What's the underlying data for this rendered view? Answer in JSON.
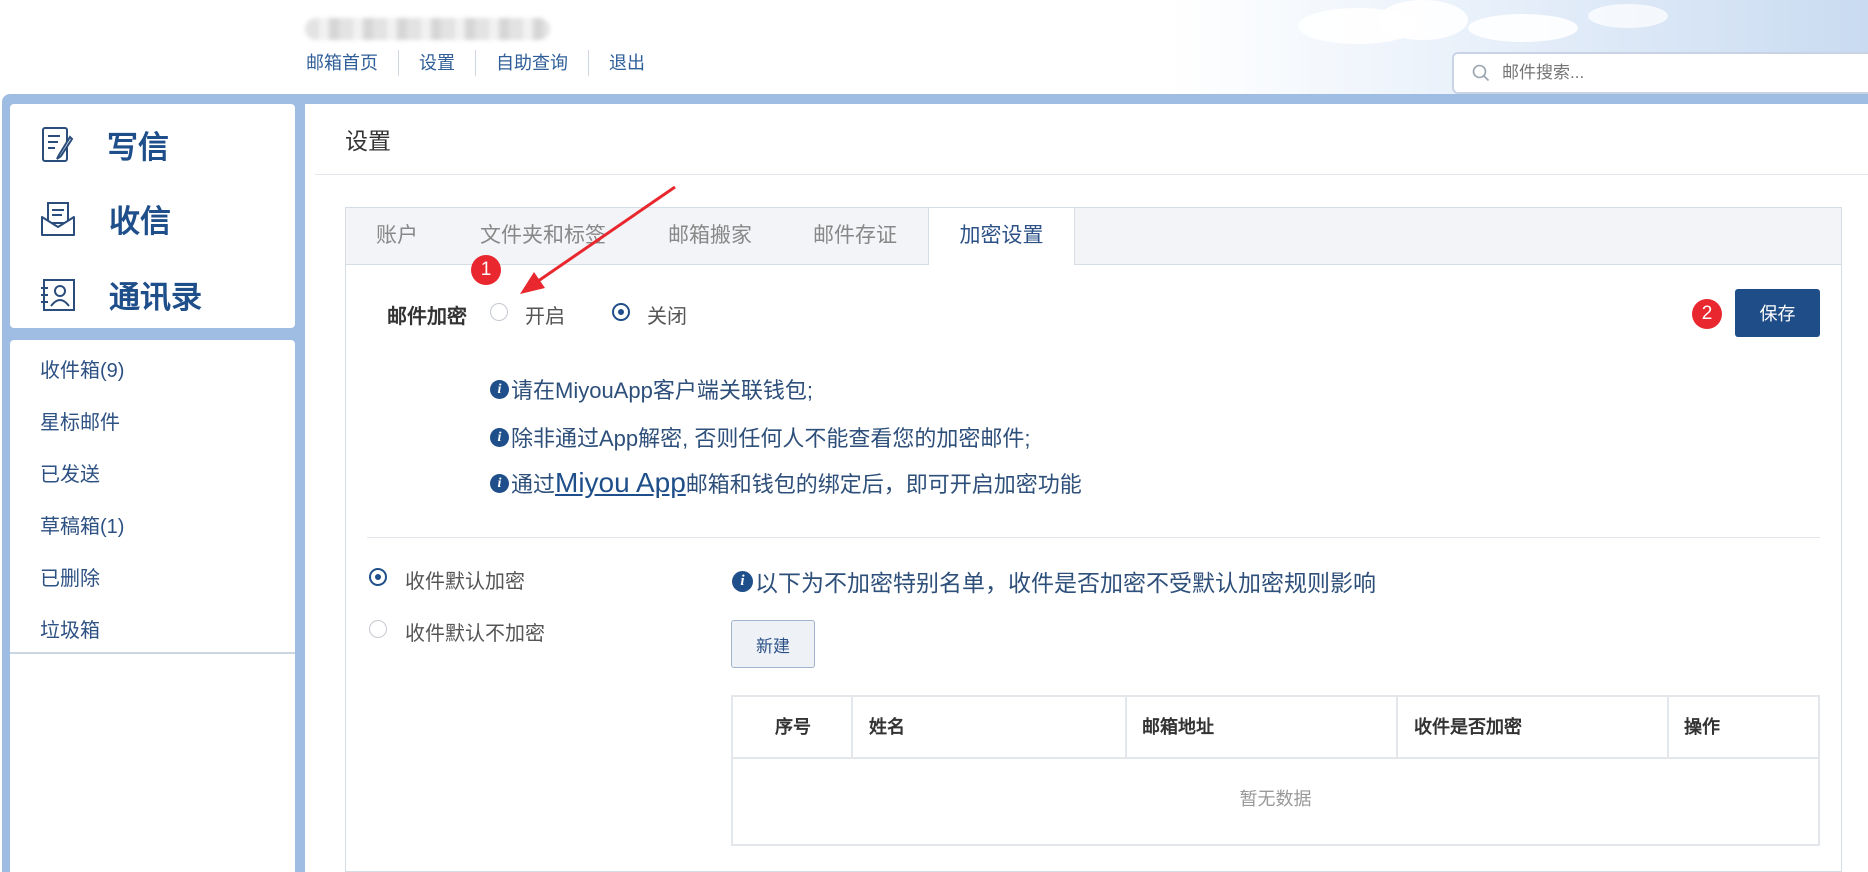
{
  "header": {
    "nav": [
      "邮箱首页",
      "设置",
      "自助查询",
      "退出"
    ],
    "search_placeholder": "邮件搜索..."
  },
  "sidebar": {
    "actions": [
      {
        "label": "写信",
        "icon": "compose-icon"
      },
      {
        "label": "收信",
        "icon": "inbox-envelope-icon"
      },
      {
        "label": "通讯录",
        "icon": "contacts-icon"
      }
    ],
    "folders": [
      "收件箱(9)",
      "星标邮件",
      "已发送",
      "草稿箱(1)",
      "已删除",
      "垃圾箱"
    ]
  },
  "main": {
    "title": "设置",
    "tabs": [
      "账户",
      "文件夹和标签",
      "邮箱搬家",
      "邮件存证",
      "加密设置"
    ],
    "active_tab": "加密设置",
    "encryption": {
      "label": "邮件加密",
      "options": [
        "开启",
        "关闭"
      ],
      "selected": "关闭"
    },
    "save_label": "保存",
    "badges": [
      "1",
      "2"
    ],
    "info": {
      "line1": "请在MiyouApp客户端关联钱包;",
      "line2": "除非通过App解密, 否则任何人不能查看您的加密邮件;",
      "line3_prefix": "通过",
      "line3_link": "Miyou App",
      "line3_suffix": "邮箱和钱包的绑定后，即可开启加密功能"
    },
    "receive_options": [
      "收件默认加密",
      "收件默认不加密"
    ],
    "receive_selected": "收件默认加密",
    "whitelist_note": "以下为不加密特别名单，收件是否加密不受默认加密规则影响",
    "new_label": "新建",
    "table": {
      "columns": [
        "序号",
        "姓名",
        "邮箱地址",
        "收件是否加密",
        "操作"
      ],
      "empty_text": "暂无数据"
    }
  },
  "colors": {
    "brand": "#1e4d87",
    "frame": "#9fbde3",
    "annotation": "#e8282e"
  }
}
